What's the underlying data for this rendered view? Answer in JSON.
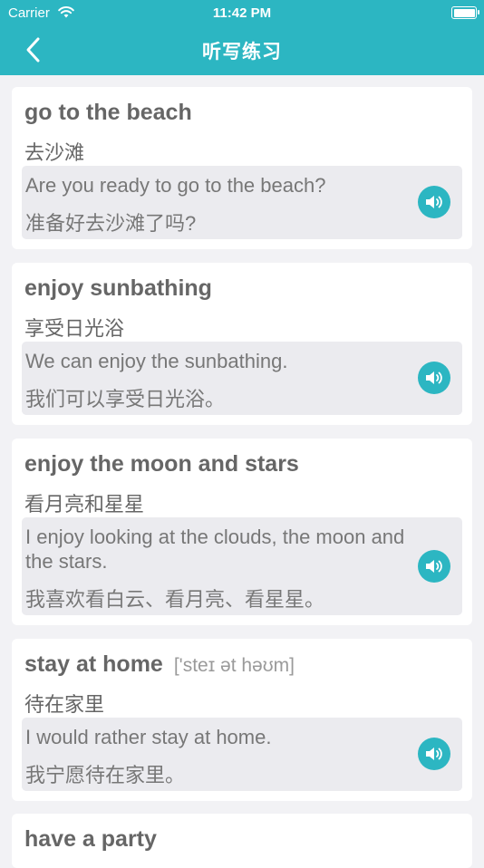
{
  "status_bar": {
    "carrier": "Carrier",
    "time": "11:42 PM"
  },
  "header": {
    "title": "听写练习"
  },
  "cards": [
    {
      "word": "go to the beach",
      "phonetic": "",
      "meaning": "去沙滩",
      "example_en": "Are you ready to go to the beach?",
      "example_zh": "准备好去沙滩了吗?"
    },
    {
      "word": "enjoy sunbathing",
      "phonetic": "",
      "meaning": "享受日光浴",
      "example_en": "We can enjoy the sunbathing.",
      "example_zh": "我们可以享受日光浴。"
    },
    {
      "word": "enjoy the moon and stars",
      "phonetic": "",
      "meaning": "看月亮和星星",
      "example_en": "I enjoy looking at the clouds, the moon and the stars.",
      "example_zh": "我喜欢看白云、看月亮、看星星。"
    },
    {
      "word": "stay at home",
      "phonetic": "['steɪ ət həʊm]",
      "meaning": "待在家里",
      "example_en": "I would rather stay at home.",
      "example_zh": "我宁愿待在家里。"
    },
    {
      "word": "have a party",
      "phonetic": "",
      "meaning": "",
      "example_en": "",
      "example_zh": ""
    }
  ],
  "colors": {
    "accent": "#2cb6c2",
    "background": "#f2f2f5",
    "example_bg": "#ebebef"
  },
  "icons": {
    "back": "chevron-left-icon",
    "speaker": "speaker-icon",
    "wifi": "wifi-icon",
    "battery": "battery-icon"
  }
}
